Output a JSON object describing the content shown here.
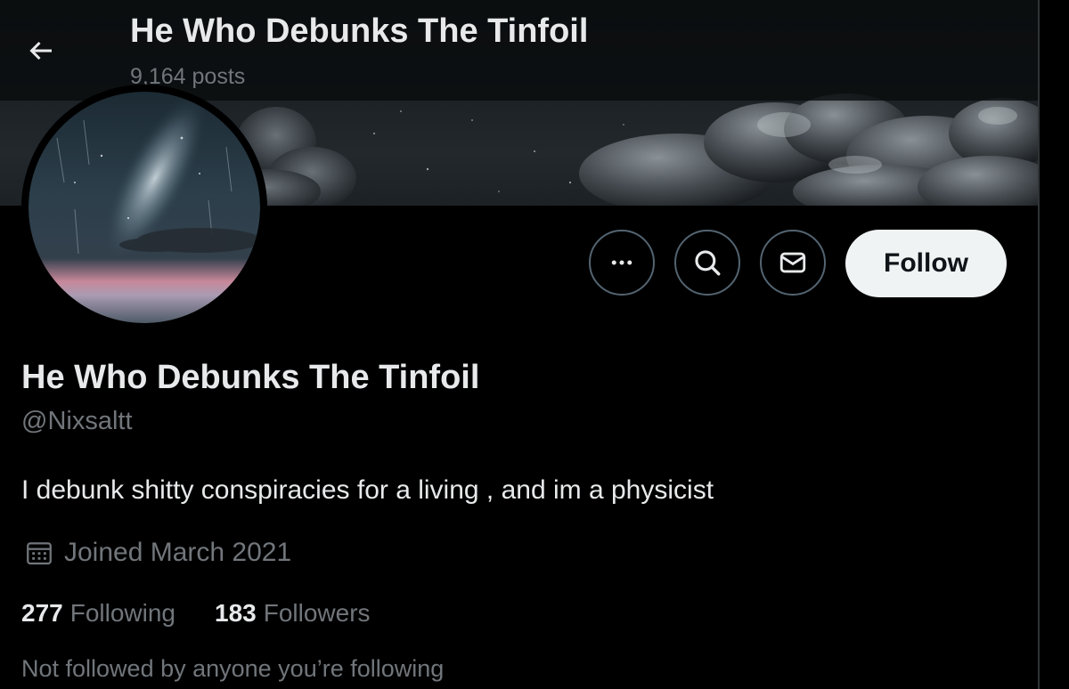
{
  "header": {
    "title": "He Who Debunks The Tinfoil",
    "posts": "9,164 posts",
    "back_icon": "arrow-left-icon"
  },
  "actions": {
    "more_icon": "more-dots-icon",
    "search_icon": "search-icon",
    "message_icon": "envelope-icon",
    "follow_label": "Follow"
  },
  "profile": {
    "display_name": "He Who Debunks The Tinfoil",
    "handle": "@Nixsaltt",
    "bio": "I debunk shitty conspiracies for a living , and im a physicist",
    "joined": "Joined March 2021",
    "joined_icon": "calendar-icon",
    "following_count": "277",
    "following_label": "Following",
    "followers_count": "183",
    "followers_label": "Followers",
    "not_followed_note": "Not followed by anyone you’re following"
  },
  "colors": {
    "background": "#000000",
    "primary_text": "#e7e9ea",
    "secondary_text": "#71767b",
    "border": "#536471",
    "follow_button_bg": "#eff3f4",
    "follow_button_text": "#0f1419"
  }
}
